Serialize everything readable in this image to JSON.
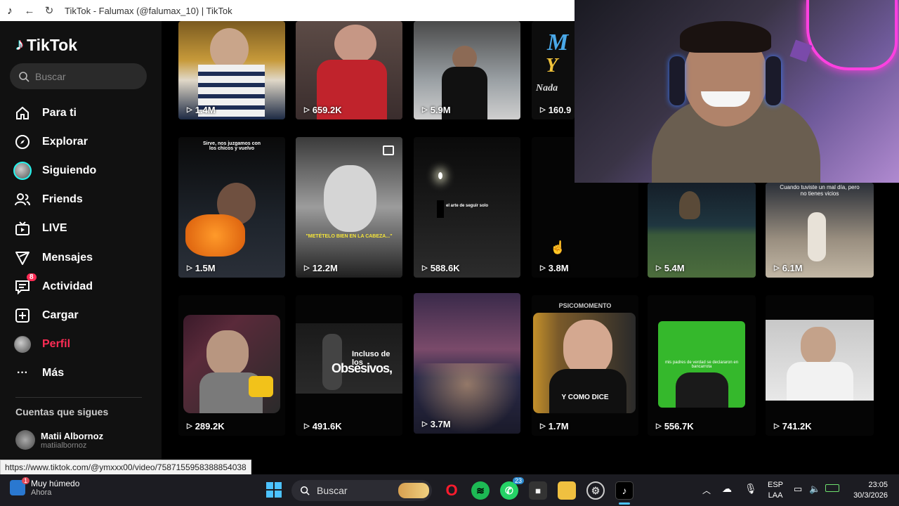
{
  "browser": {
    "title": "TikTok - Falumax (@falumax_10) | TikTok"
  },
  "sidebar": {
    "logo": "TikTok",
    "search_placeholder": "Buscar",
    "items": [
      {
        "label": "Para ti",
        "icon": "home-icon"
      },
      {
        "label": "Explorar",
        "icon": "compass-icon"
      },
      {
        "label": "Siguiendo",
        "icon": "avatar-icon"
      },
      {
        "label": "Friends",
        "icon": "friends-icon"
      },
      {
        "label": "LIVE",
        "icon": "live-tv-icon"
      },
      {
        "label": "Mensajes",
        "icon": "send-icon"
      },
      {
        "label": "Actividad",
        "icon": "activity-icon",
        "badge": "8"
      },
      {
        "label": "Cargar",
        "icon": "upload-plus-icon"
      },
      {
        "label": "Perfil",
        "icon": "profile-avatar-icon",
        "active": true
      },
      {
        "label": "Más",
        "icon": "more-dots-icon"
      }
    ],
    "following_title": "Cuentas que sigues",
    "following": [
      {
        "name": "Matii Albornoz",
        "handle": "matiialbornoz"
      }
    ]
  },
  "grid": {
    "row1": [
      "1.4M",
      "659.2K",
      "5.9M",
      "160.9"
    ],
    "row2": [
      "1.5M",
      "12.2M",
      "588.6K",
      "3.8M",
      "5.4M",
      "6.1M"
    ],
    "row3": [
      "289.2K",
      "491.6K",
      "3.7M",
      "1.7M",
      "556.7K",
      "741.2K"
    ],
    "captions": {
      "row1_tile4": [
        "M",
        "Y",
        "Nada"
      ],
      "row2_tile1": "Sirve, nos juzgamos con los chicos y vuelvo",
      "row2_tile2": "\"METÉTELO BIEN EN LA CABEZA...\"",
      "row2_tile3": "el arte de seguir solo",
      "row2_tile6": "Cuando tuviste un mal día, pero no tienes vicios",
      "row3_tile2_a": "Incluso de los",
      "row3_tile2_b": "Obsesivos,",
      "row3_tile4_header": "PSICOMOMENTO",
      "row3_tile4": "Y COMO DICE",
      "row3_tile5": "mis padres de verdad se declararon en bancarrota"
    }
  },
  "url_hint": "https://www.tiktok.com/@ymxxx00/video/7587155958388854038",
  "taskbar": {
    "weather_title": "Muy húmedo",
    "weather_sub": "Ahora",
    "weather_badge": "1",
    "search": "Buscar",
    "whatsapp_badge": "23",
    "lang1": "ESP",
    "lang2": "LAA",
    "time": "23:05",
    "date": "30/3/2026"
  }
}
